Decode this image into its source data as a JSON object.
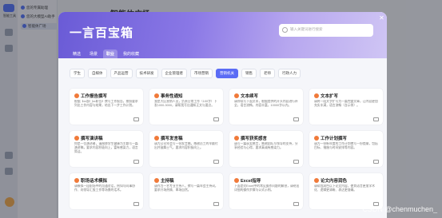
{
  "app": {
    "rail_label": "智能工具",
    "sidebar_items": [
      "您的专属助理",
      "您的大模型AI助手",
      "智能体广场"
    ],
    "page_title": "智能体广场"
  },
  "modal": {
    "title": "一言百宝箱",
    "search_placeholder": "输入关键词进行搜索",
    "tabs": [
      "精选",
      "场景",
      "职业",
      "我的收藏"
    ],
    "active_tab": "职业",
    "categories": [
      "学生",
      "自媒体",
      "产品运营",
      "技术研发",
      "企业管理者",
      "市场营销",
      "营销机关",
      "销售",
      "老师",
      "行政人力"
    ],
    "active_category": "营销机关",
    "cards": [
      {
        "title": "工作报告撰写",
        "desc": "根据【xx部门xx职位】撰写工作报告，按照要求列出工作内容与结果，给出下一步工作计划。"
      },
      {
        "title": "事务性通知",
        "desc": "我是大区营销人员，负责日常工作（100字）下发1000-3000，请帮我写出通知正文与要点。"
      },
      {
        "title": "文本续写",
        "desc": "请你续写下面文本，根据提供的开头内容进行补全，语言流畅，内容丰富，10000字以内。"
      },
      {
        "title": "文本扩写",
        "desc": "请将一段文字扩写为一篇完整文章，让内容更加充实丰满，语言流畅（含示例）。"
      },
      {
        "title": "撰写演讲稿",
        "desc": "你是一位演讲者，请围绕学生健康为主题写一篇演讲稿，要求内容积极向上，富有感染力，语言简洁。"
      },
      {
        "title": "撰写发言稿",
        "desc": "请为公司年会写一份发言稿，感谢员工的辛勤付出并鼓舞士气，要求内容积极向上。"
      },
      {
        "title": "撰写获奖感言",
        "desc": "请写一篇获奖感言，感谢团队与领导的支持，分享经验与心得，要求真诚有感染力。"
      },
      {
        "title": "工作计划撰写",
        "desc": "请为一份新年度的工作计划撰写一份提纲，包括目标、措施与时间安排等内容。"
      },
      {
        "title": "职场话术模拟",
        "desc": "请模拟一段职场中的沟通对话，例如与同事协作、向领导汇报工作等场景的话术。"
      },
      {
        "title": "主持稿",
        "desc": "请作为一名专业主持人，撰写一篇年会主持词，要求开场热情、串场自然。"
      },
      {
        "title": "Excel指导",
        "desc": "下面是对Excel中的常见操作问题的解答，请给出详细的操作步骤与公式示例。"
      },
      {
        "title": "论文内容润色",
        "desc": "请帮我润色以下论文内容，使其语言更加学术化、逻辑更清晰、表达更准确。"
      }
    ]
  },
  "watermark": "CSDN @chenmuchen_"
}
